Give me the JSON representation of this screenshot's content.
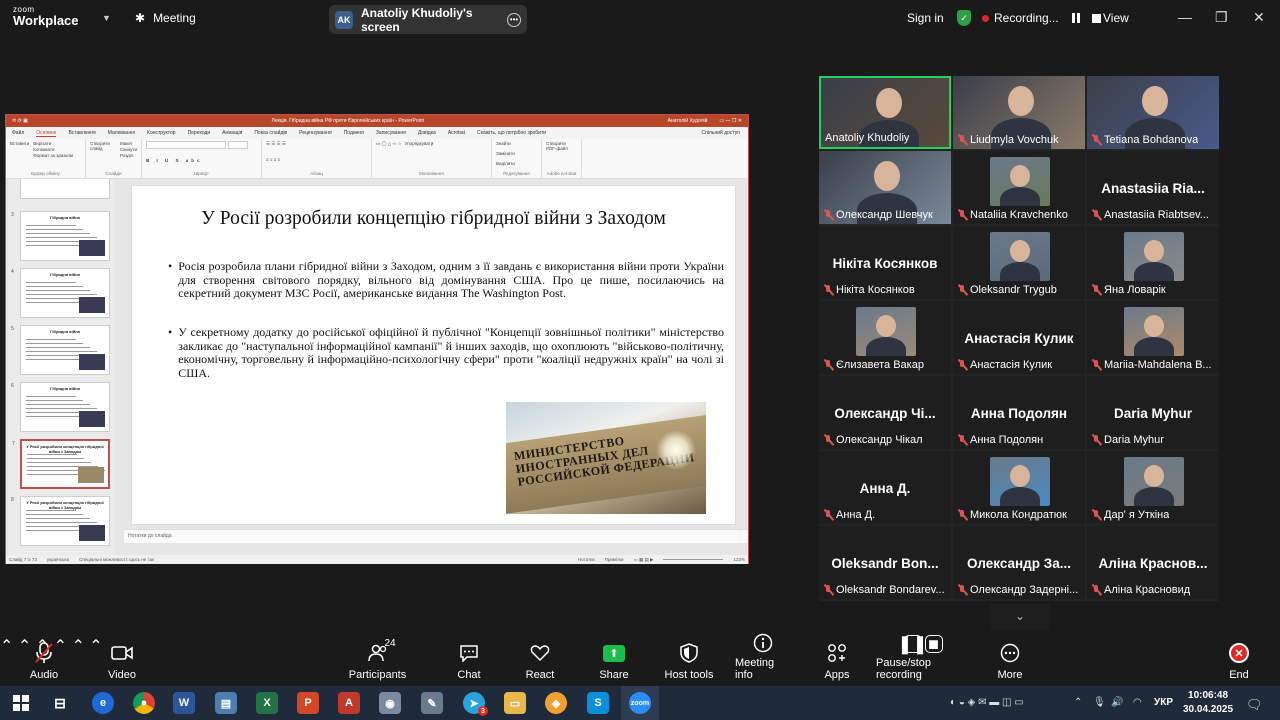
{
  "zoom": {
    "logo_line1": "zoom",
    "logo_line2": "Workplace",
    "meeting_label": "Meeting",
    "sharer_initials": "AK",
    "sharer_screen": "Anatoliy Khudoliy's screen",
    "sign_in": "Sign in",
    "recording_label": "Recording...",
    "view_label": "View"
  },
  "ppt": {
    "title_bar": "Лекція. Гібридна війна РФ проти Європейських країн - PowerPoint",
    "user": "Анатолій Худолій",
    "menu": [
      "Файл",
      "Основне",
      "Вставлення",
      "Малювання",
      "Конструктор",
      "Переходи",
      "Анімація",
      "Показ слайдів",
      "Рецензування",
      "Подання",
      "Запису­вання",
      "Довідка",
      "Acrobat",
      "Скажіть, що потрібно зробити",
      "Спільний доступ"
    ],
    "ribbon_groups": [
      "Буфер обміну",
      "Слайди",
      "Шрифт",
      "Абзац",
      "Малювання",
      "Редагування",
      "Adobe Acrobat"
    ],
    "ribbon_items": {
      "paste": "Вставити",
      "cut": "Вирізати",
      "copy": "Копіювати",
      "format": "Формат за зразком",
      "new_slide": "Створити слайд",
      "layout": "Макет",
      "reset": "Скинути",
      "section": "Розділ",
      "arrange": "Упорядкувати",
      "find": "Знайти",
      "replace": "Замінити",
      "select": "Виділити",
      "pdf": "Створити PDF-файл"
    },
    "thumbnails": [
      {
        "num": "3",
        "title": "Гібридна війна"
      },
      {
        "num": "4",
        "title": "Гібридна війна"
      },
      {
        "num": "5",
        "title": "Гібридна війна"
      },
      {
        "num": "6",
        "title": "Гібридна війна"
      },
      {
        "num": "7",
        "title": "У Росії розробили концепцію гібридної війни з Заходом"
      },
      {
        "num": "8",
        "title": "У Росії розробили концепцію гібридної війни з Заходом"
      }
    ],
    "slide": {
      "title": "У Росії розробили концепцію гібридної війни з Заходом",
      "bullet1": "Росія розробила плани гібридної війни з Заходом, одним з її завдань є використання війни проти України для створення світового порядку, вільного від домінування США. Про це пише, посилаючись на секретний документ МЗС Росії, американське видання The Washington Post.",
      "bullet2": "У секретному додатку до російської офіційної й публічної \"Концепції зовнішньої політики\" міністерство закликає до \"наступальної інформаційної кампанії\" й інших заходів, що охоплюють \"військово-політичну, економічну, торговельну й інформаційно-психологічну сфери\" проти \"коаліції недружніх країн\" на чолі зі США.",
      "image_sign_text": "МИНИСТЕРСТВО\nИНОСТРАННЫХ ДЕЛ\nРОССИЙСКОЙ ФЕДЕРАЦИИ"
    },
    "notes_placeholder": "Нотатки до слайда",
    "status": {
      "slide_counter": "Слайд 7 із 73",
      "language": "українська",
      "accessibility": "Спеціальні можливості: щось не так",
      "notes": "Нотатки",
      "comments": "Примітки",
      "zoom": "122%"
    }
  },
  "participants": [
    {
      "name": "Anatoliy Khudoliy",
      "video": true,
      "active": true,
      "muted": false,
      "tone": "#5a4a3a"
    },
    {
      "name": "Liudmyla Vovchuk",
      "video": true,
      "muted": true,
      "tone": "#8a7a6a"
    },
    {
      "name": "Tetiana Bohdanova",
      "video": true,
      "muted": true,
      "tone": "#4a5a8a"
    },
    {
      "name": "Олександр Шевчук",
      "video": true,
      "muted": true,
      "tone": "#7a8a9a"
    },
    {
      "name": "Nataliia Kravchenko",
      "video": "photo",
      "muted": true,
      "tone": "#6a7a5a"
    },
    {
      "name": "Anastasiia Riabtsev...",
      "big": "Anastasiia Ria...",
      "muted": true
    },
    {
      "name": "Нікіта Косянков",
      "big": "Нікіта Косянков",
      "muted": true
    },
    {
      "name": "Oleksandr Trygub",
      "video": "photo",
      "muted": true,
      "tone": "#5a6a7a"
    },
    {
      "name": "Яна Ловарік",
      "video": "photo",
      "muted": true,
      "tone": "#8a8a8a"
    },
    {
      "name": "Єлизавета Вакар",
      "video": "photo",
      "muted": true,
      "tone": "#9a8a7a"
    },
    {
      "name": "Анастасія Кулик",
      "big": "Анастасія Кулик",
      "muted": true
    },
    {
      "name": "Mariia-Mahdalena B...",
      "video": "photo",
      "muted": true,
      "tone": "#b08a6a"
    },
    {
      "name": "Олександр Чікал",
      "big": "Олександр Чі...",
      "muted": true
    },
    {
      "name": "Анна Подолян",
      "big": "Анна Подолян",
      "muted": true
    },
    {
      "name": "Daria Myhur",
      "big": "Daria Myhur",
      "muted": true
    },
    {
      "name": "Анна Д.",
      "big": "Анна Д.",
      "muted": true
    },
    {
      "name": "Микола Кондратюк",
      "video": "photo",
      "muted": true,
      "tone": "#4a8ac0"
    },
    {
      "name": "Дар' я Уткіна",
      "video": "photo",
      "muted": true,
      "tone": "#7a7a7a"
    },
    {
      "name": "Oleksandr Bondarev...",
      "big": "Oleksandr Bon...",
      "muted": true
    },
    {
      "name": "Олександр Задерні...",
      "big": "Олександр За...",
      "muted": true
    },
    {
      "name": "Аліна Красновид",
      "big": "Аліна Краснов...",
      "muted": true
    }
  ],
  "toolbar": {
    "audio": "Audio",
    "video": "Video",
    "participants": "Participants",
    "participants_count": "24",
    "chat": "Chat",
    "react": "React",
    "share": "Share",
    "host_tools": "Host tools",
    "meeting_info": "Meeting info",
    "apps": "Apps",
    "pause_stop": "Pause/stop recording",
    "more": "More",
    "end": "End"
  },
  "taskbar": {
    "language": "УКР",
    "time": "10:06:48",
    "date": "30.04.2025",
    "telegram_badge": "3"
  },
  "colors": {
    "ppt_accent": "#b7472a",
    "active_speaker": "#23d160",
    "share_green": "#1bbe4a",
    "end_red": "#e02828"
  }
}
